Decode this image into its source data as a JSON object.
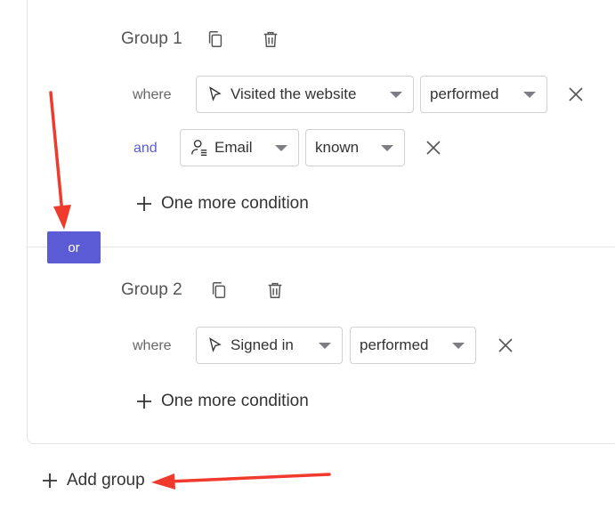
{
  "groups": [
    {
      "title": "Group 1",
      "conditions": [
        {
          "connector": "where",
          "event": "Visited the website",
          "operator": "performed"
        },
        {
          "connector": "and",
          "event": "Email",
          "operator": "known"
        }
      ],
      "add_condition": "One more condition"
    },
    {
      "title": "Group 2",
      "conditions": [
        {
          "connector": "where",
          "event": "Signed in",
          "operator": "performed"
        }
      ],
      "add_condition": "One more condition"
    }
  ],
  "or_label": "or",
  "add_group": "Add group",
  "colors": {
    "accent": "#5b5bd6",
    "annotation_arrow": "#f03a2e",
    "border": "#d0d0d4"
  },
  "icons": [
    "copy-icon",
    "trash-icon",
    "cursor-icon",
    "user-attribute-icon",
    "close-icon",
    "plus-icon",
    "caret-down-icon"
  ]
}
